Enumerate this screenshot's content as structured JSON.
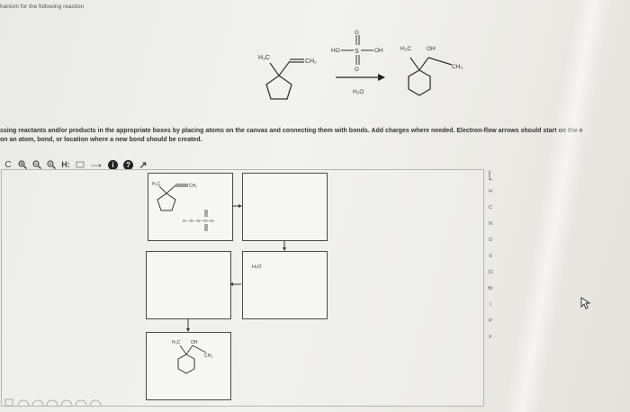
{
  "page": {
    "heading": "hanism for the following reaction",
    "instructions_line1": "ssing reactants and/or products in the appropriate boxes by placing atoms on the canvas and connecting them with bonds. Add charges where needed. Electron-flow arrows should start on the e",
    "instructions_line2": "on an atom, bond, or location where a new bond should be created."
  },
  "reaction": {
    "reactant_labels": {
      "h3c": "H₃C",
      "ch2": "CH₂"
    },
    "reagent": {
      "ho_left": "HO",
      "s": "S",
      "oh_right": "OH",
      "o_top": "O",
      "o_bottom": "O"
    },
    "solvent": "H₂O",
    "product_labels": {
      "h3c": "H₃C",
      "oh": "OH",
      "ch3": "CH₃"
    }
  },
  "toolbar": {
    "c_label": "C",
    "h_label": "H:",
    "info_label": "i",
    "help_label": "?",
    "arrow_label": "↗"
  },
  "canvas": {
    "box1": {
      "h3c": "H₃C",
      "ch2": "CH₂",
      "reagent": "H—O—S—O—H"
    },
    "box4": {
      "h2o": "H₂O"
    },
    "box5": {
      "h3c": "H₃C",
      "oh": "OH",
      "ch3": "CH₃"
    }
  },
  "sidebar": {
    "elements": [
      "H",
      "C",
      "N",
      "O",
      "S",
      "Cl",
      "Br",
      "I",
      "P",
      "F"
    ]
  }
}
